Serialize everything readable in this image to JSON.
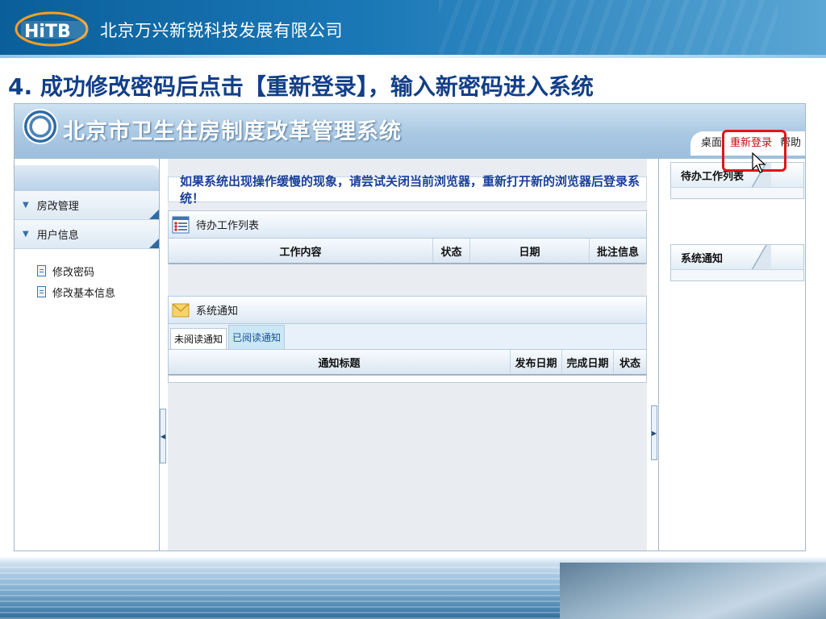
{
  "slide": {
    "company_name": "北京万兴新锐科技发展有限公司",
    "logo_text": "HiTB",
    "step_title": "4.  成功修改密码后点击【重新登录】，输入新密码进入系统"
  },
  "app": {
    "title": "北京市卫生住房制度改革管理系统",
    "top_nav": {
      "desktop": "桌面",
      "relogin": "重新登录",
      "help": "帮助"
    },
    "sidebar": {
      "menu": [
        {
          "label": "房改管理",
          "icon": "chevron-down-icon"
        },
        {
          "label": "用户信息",
          "icon": "chevron-down-icon"
        }
      ],
      "submenu": [
        {
          "label": "修改密码",
          "icon": "document-icon"
        },
        {
          "label": "修改基本信息",
          "icon": "document-icon"
        }
      ]
    },
    "main": {
      "notice": "如果系统出现操作缓慢的现象，请尝试关闭当前浏览器，重新打开新的浏览器后登录系统！",
      "todo_panel": {
        "title": "待办工作列表",
        "columns": [
          "工作内容",
          "状态",
          "日期",
          "批注信息"
        ]
      },
      "notify_panel": {
        "title": "系统通知",
        "tabs": [
          "未阅读通知",
          "已阅读通知"
        ],
        "columns": [
          "通知标题",
          "发布日期",
          "完成日期",
          "状态"
        ]
      }
    },
    "right": {
      "todo_tab": "待办工作列表",
      "notify_tab": "系统通知"
    }
  },
  "colors": {
    "highlight": "#e0141a",
    "title": "#123f88",
    "notice": "#1a3f9a"
  }
}
